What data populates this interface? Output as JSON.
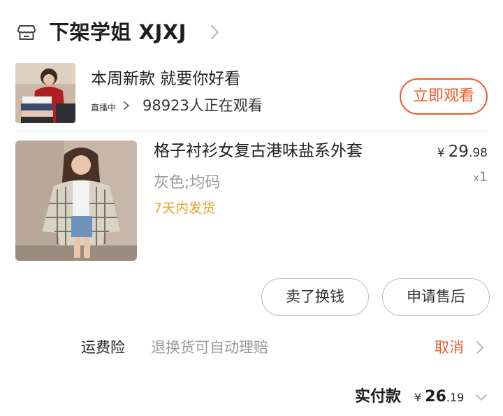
{
  "store": {
    "name": "下架学姐 XJXJ",
    "icon": "store-icon",
    "chevron_icon": "chevron-right-icon"
  },
  "live": {
    "title": "本周新款 就要你好看",
    "status": "直播中",
    "viewers": "98923",
    "viewers_suffix": "人正在观看",
    "watch_button": "立即观看",
    "accent_color": "#ec5b28"
  },
  "product": {
    "title": "格子衬衫女复古港味盐系外套",
    "variant": "灰色;均码",
    "shipping": "7天内发货",
    "shipping_color": "#f0a020",
    "price_currency": "¥",
    "price_integer": "29",
    "price_decimal": ".98",
    "quantity_prefix": "x",
    "quantity": "1"
  },
  "actions": {
    "sell": "卖了换钱",
    "after_sale": "申请售后"
  },
  "insurance": {
    "label": "运费险",
    "description": "退换货可自动理赔",
    "cancel": "取消"
  },
  "payment": {
    "label": "实付款",
    "currency": "¥",
    "integer": "26",
    "decimal": ".19",
    "chevron_icon": "chevron-down-icon"
  }
}
